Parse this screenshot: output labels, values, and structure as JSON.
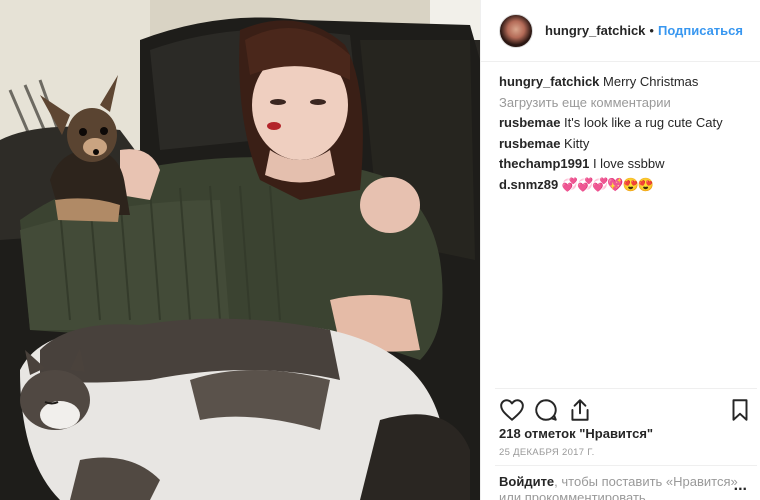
{
  "post": {
    "username": "hungry_fatchick",
    "separator": "•",
    "follow_label": "Подписаться",
    "caption_author": "hungry_fatchick",
    "caption_text": "Merry Christmas",
    "load_more_label": "Загрузить еще комментарии",
    "comments": [
      {
        "author": "rusbemae",
        "text": "It's look like a rug cute Caty"
      },
      {
        "author": "rusbemae",
        "text": "Kitty"
      },
      {
        "author": "thechamp1991",
        "text": "I love ssbbw"
      },
      {
        "author": "d.snmz89",
        "text": "💞💞💞💖😍😍"
      }
    ],
    "likes_label": "218 отметок \"Нравится\"",
    "date_label": "25 ДЕКАБРЯ 2017 Г.",
    "footer_login": "Войдите",
    "footer_text": ", чтобы поставить «Нравится» или прокомментировать.",
    "more_label": "..."
  },
  "icons": {
    "like": "heart-icon",
    "comment": "comment-icon",
    "share": "share-icon",
    "save": "bookmark-icon"
  },
  "colors": {
    "link": "#3897f0",
    "text": "#262626",
    "muted": "#999999",
    "divider": "#efefef"
  }
}
